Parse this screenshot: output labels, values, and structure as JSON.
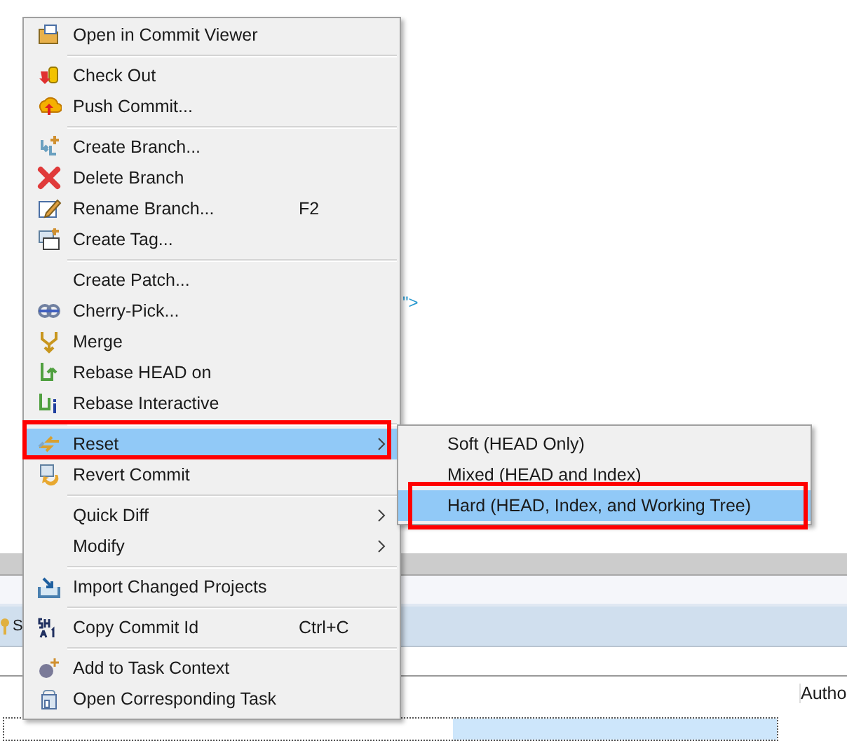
{
  "editor": {
    "code_fragment": "\">"
  },
  "history_view": {
    "row_label": "S",
    "column_header": "Autho"
  },
  "context_menu": {
    "groups": [
      [
        {
          "label": "Open in Commit Viewer",
          "selected": false,
          "submenu": false,
          "annotated": false
        }
      ],
      [
        {
          "label": "Check Out",
          "selected": false,
          "submenu": false,
          "annotated": false
        },
        {
          "label": "Push Commit...",
          "selected": false,
          "submenu": false,
          "annotated": false
        }
      ],
      [
        {
          "label": "Create Branch...",
          "selected": false,
          "submenu": false,
          "annotated": false
        },
        {
          "label": "Delete Branch",
          "selected": false,
          "submenu": false,
          "annotated": false
        },
        {
          "label": "Rename Branch...",
          "shortcut": "F2",
          "selected": false,
          "submenu": false,
          "annotated": false
        },
        {
          "label": "Create Tag...",
          "selected": false,
          "submenu": false,
          "annotated": false
        }
      ],
      [
        {
          "label": "Create Patch...",
          "selected": false,
          "submenu": false,
          "annotated": false
        },
        {
          "label": "Cherry-Pick...",
          "selected": false,
          "submenu": false,
          "annotated": false
        },
        {
          "label": "Merge",
          "selected": false,
          "submenu": false,
          "annotated": false
        },
        {
          "label": "Rebase HEAD on",
          "selected": false,
          "submenu": false,
          "annotated": false
        },
        {
          "label": "Rebase Interactive",
          "selected": false,
          "submenu": false,
          "annotated": false
        }
      ],
      [
        {
          "label": "Reset",
          "selected": true,
          "submenu": true,
          "annotated": true
        },
        {
          "label": "Revert Commit",
          "selected": false,
          "submenu": false,
          "annotated": false
        }
      ],
      [
        {
          "label": "Quick Diff",
          "selected": false,
          "submenu": true,
          "annotated": false
        },
        {
          "label": "Modify",
          "selected": false,
          "submenu": true,
          "annotated": false
        }
      ],
      [
        {
          "label": "Import Changed Projects",
          "selected": false,
          "submenu": false,
          "annotated": false
        }
      ],
      [
        {
          "label": "Copy Commit Id",
          "shortcut": "Ctrl+C",
          "selected": false,
          "submenu": false,
          "annotated": false
        }
      ],
      [
        {
          "label": "Add to Task Context",
          "selected": false,
          "submenu": false,
          "annotated": false
        },
        {
          "label": "Open Corresponding Task",
          "selected": false,
          "submenu": false,
          "annotated": false
        }
      ]
    ]
  },
  "reset_submenu": {
    "items": [
      {
        "label": "Soft (HEAD Only)",
        "selected": false,
        "annotated": false
      },
      {
        "label": "Mixed (HEAD and Index)",
        "selected": false,
        "annotated": false
      },
      {
        "label": "Hard (HEAD, Index, and Working Tree)",
        "selected": true,
        "annotated": true
      }
    ]
  }
}
